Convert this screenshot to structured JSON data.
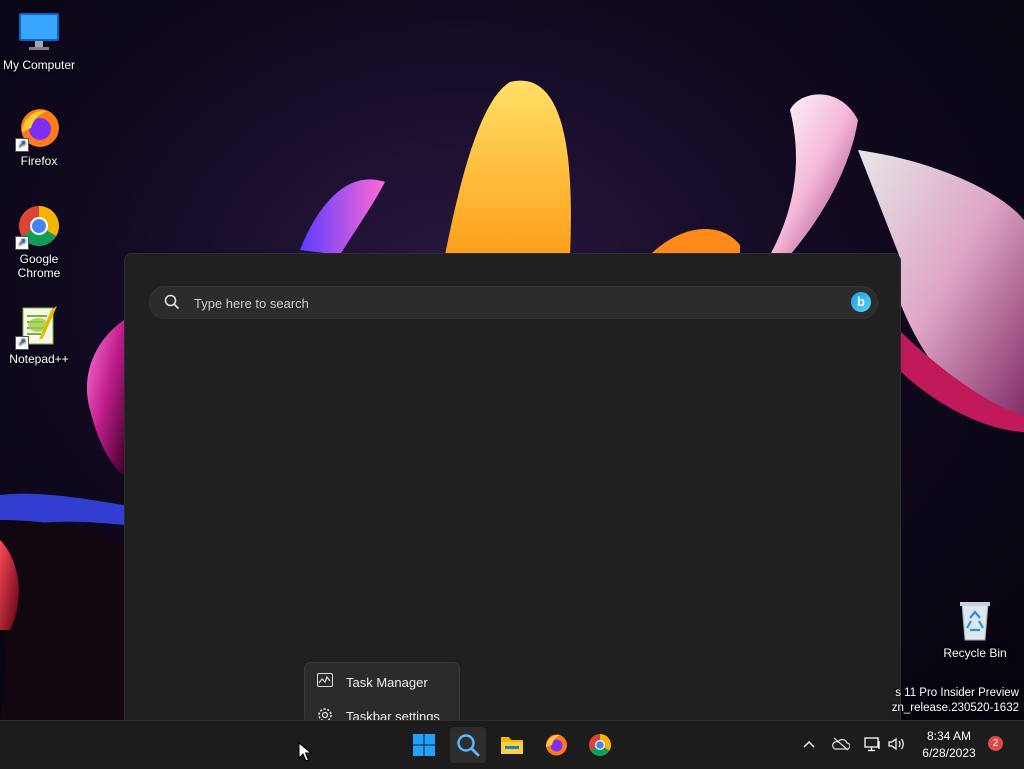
{
  "desktop": {
    "icons": [
      {
        "label": "My Computer",
        "icon": "monitor-icon"
      },
      {
        "label": "Firefox",
        "icon": "firefox-icon"
      },
      {
        "label": "Google Chrome",
        "icon": "chrome-icon"
      },
      {
        "label": "Notepad++",
        "icon": "notepadpp-icon"
      },
      {
        "label": "Recycle Bin",
        "icon": "recycle-bin-icon"
      }
    ]
  },
  "search": {
    "placeholder": "Type here to search",
    "bing_label": "b"
  },
  "context_menu": {
    "items": [
      {
        "label": "Task Manager",
        "icon": "task-manager-icon"
      },
      {
        "label": "Taskbar settings",
        "icon": "gear-icon"
      }
    ]
  },
  "watermark": {
    "line1": "s 11 Pro Insider Preview",
    "line2": "zn_release.230520-1632"
  },
  "taskbar": {
    "apps": [
      "start-icon",
      "search-icon",
      "file-explorer-icon",
      "firefox-icon",
      "chrome-icon"
    ],
    "tray": [
      "chevron-up-icon",
      "onedrive-icon",
      "network-icon",
      "volume-icon"
    ],
    "time": "8:34 AM",
    "date": "6/28/2023",
    "notification_count": "2"
  },
  "colors": {
    "flyout_bg": "#202020",
    "taskbar_bg": "#1c1c1c",
    "accent": "#0078d4"
  }
}
